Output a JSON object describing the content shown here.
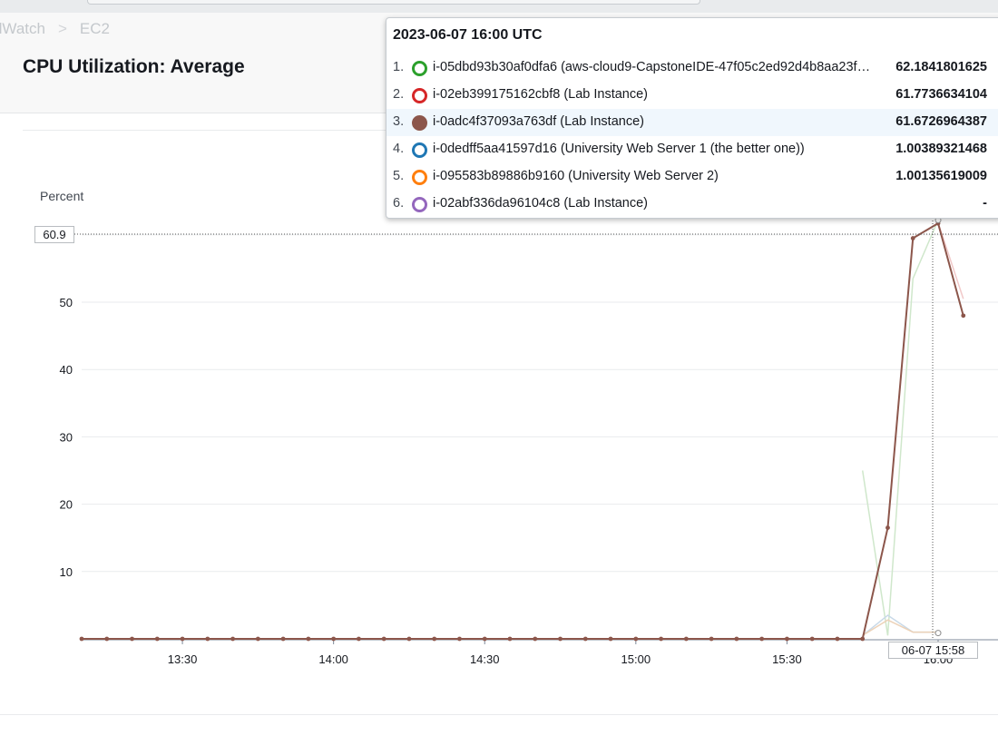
{
  "breadcrumb": [
    "CloudWatch",
    "EC2"
  ],
  "widget": {
    "title": "CPU Utilization: Average"
  },
  "tooltip": {
    "timestamp": "2023-06-07 16:00 UTC",
    "rows": [
      {
        "index": "1.",
        "marker": "ring",
        "color": "#2ca02c",
        "label": "i-05dbd93b30af0dfa6 (aws-cloud9-CapstoneIDE-47f05c2ed92d4b8aa23f…",
        "value": "62.1841801625"
      },
      {
        "index": "2.",
        "marker": "ring",
        "color": "#d62728",
        "label": "i-02eb399175162cbf8 (Lab Instance)",
        "value": "61.7736634104"
      },
      {
        "index": "3.",
        "marker": "dot",
        "color": "#8c564b",
        "label": "i-0adc4f37093a763df (Lab Instance)",
        "value": "61.6726964387",
        "highlighted": true
      },
      {
        "index": "4.",
        "marker": "ring",
        "color": "#1f77b4",
        "label": "i-0dedff5aa41597d16 (University Web Server 1 (the better one))",
        "value": "1.00389321468"
      },
      {
        "index": "5.",
        "marker": "ring",
        "color": "#ff7f0e",
        "label": "i-095583b89886b9160 (University Web Server 2)",
        "value": "1.00135619009"
      },
      {
        "index": "6.",
        "marker": "ring",
        "color": "#9467bd",
        "label": "i-02abf336da96104c8 (Lab Instance)",
        "value": "-"
      }
    ]
  },
  "crosshair": {
    "x_label": "06-07 15:58",
    "y_label": "60.9"
  },
  "chart_data": {
    "type": "line",
    "ylabel": "Percent",
    "ylim": [
      0,
      60
    ],
    "yticks": [
      "10",
      "20",
      "30",
      "40",
      "50"
    ],
    "xticks": [
      "13:30",
      "14:00",
      "14:30",
      "15:00",
      "15:30",
      "16:00"
    ],
    "xrange": [
      "13:10",
      "16:05"
    ],
    "highlighted_series": "i-0adc4f37093a763df (Lab Instance)",
    "series": [
      {
        "name": "i-0adc4f37093a763df (Lab Instance)",
        "color": "#8c564b",
        "style": "highlighted",
        "x": [
          "13:10",
          "13:15",
          "13:20",
          "13:25",
          "13:30",
          "13:35",
          "13:40",
          "13:45",
          "13:50",
          "13:55",
          "14:00",
          "14:05",
          "14:10",
          "14:15",
          "14:20",
          "14:25",
          "14:30",
          "14:35",
          "14:40",
          "14:45",
          "14:50",
          "14:55",
          "15:00",
          "15:05",
          "15:10",
          "15:15",
          "15:20",
          "15:25",
          "15:30",
          "15:35",
          "15:40",
          "15:45",
          "15:50",
          "15:55",
          "16:00",
          "16:05"
        ],
        "y": [
          0,
          0,
          0,
          0,
          0,
          0,
          0,
          0,
          0,
          0,
          0,
          0,
          0,
          0,
          0,
          0,
          0,
          0,
          0,
          0,
          0,
          0,
          0,
          0,
          0,
          0,
          0,
          0,
          0,
          0,
          0,
          0,
          16.5,
          59.5,
          61.7,
          48.0
        ]
      },
      {
        "name": "i-05dbd93b30af0dfa6 (aws-cloud9-CapstoneIDE-47f05c2ed92d4b8aa23f…",
        "color": "#2ca02c",
        "style": "faded",
        "x": [
          "15:45",
          "15:50",
          "15:55",
          "16:00"
        ],
        "y": [
          25.0,
          0.5,
          53.5,
          62.2
        ]
      },
      {
        "name": "i-02eb399175162cbf8 (Lab Instance)",
        "color": "#d62728",
        "style": "faded",
        "x": [
          "15:55",
          "16:00",
          "16:05"
        ],
        "y": [
          59.5,
          61.8,
          50.5
        ]
      },
      {
        "name": "i-0dedff5aa41597d16 (University Web Server 1 (the better one))",
        "color": "#1f77b4",
        "style": "faded",
        "x": [
          "15:45",
          "15:50",
          "15:55",
          "16:00"
        ],
        "y": [
          0.5,
          3.5,
          1.0,
          1.0
        ]
      },
      {
        "name": "i-095583b89886b9160 (University Web Server 2)",
        "color": "#ff7f0e",
        "style": "faded",
        "x": [
          "15:45",
          "15:50",
          "15:55",
          "16:00"
        ],
        "y": [
          0.5,
          2.8,
          1.0,
          1.0
        ]
      }
    ]
  }
}
